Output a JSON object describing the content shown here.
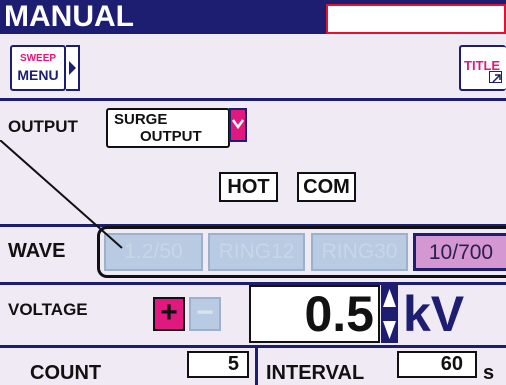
{
  "title": "MANUAL",
  "sweep_menu": {
    "line1": "SWEEP",
    "line2": "MENU"
  },
  "title_button": {
    "label": "TITLE"
  },
  "output": {
    "label": "OUTPUT",
    "value_line1": "SURGE",
    "value_line2": "OUTPUT"
  },
  "terminals": {
    "hot": "HOT",
    "com": "COM"
  },
  "wave": {
    "label": "WAVE",
    "options": [
      "1.2/50",
      "RING12",
      "RING30",
      "10/700"
    ],
    "selected": "10/700"
  },
  "voltage": {
    "label": "VOLTAGE",
    "plus": "+",
    "minus": "−",
    "value": "0.5",
    "unit": "kV"
  },
  "count": {
    "label": "COUNT",
    "value": "5"
  },
  "interval": {
    "label": "INTERVAL",
    "value": "60",
    "unit": "s"
  },
  "colors": {
    "header": "#1d1d72",
    "panel": "#f0eaf5",
    "accent": "#e8102f",
    "selected_wave": "#d597d2",
    "disabled_wave": "#b8cbe3"
  }
}
